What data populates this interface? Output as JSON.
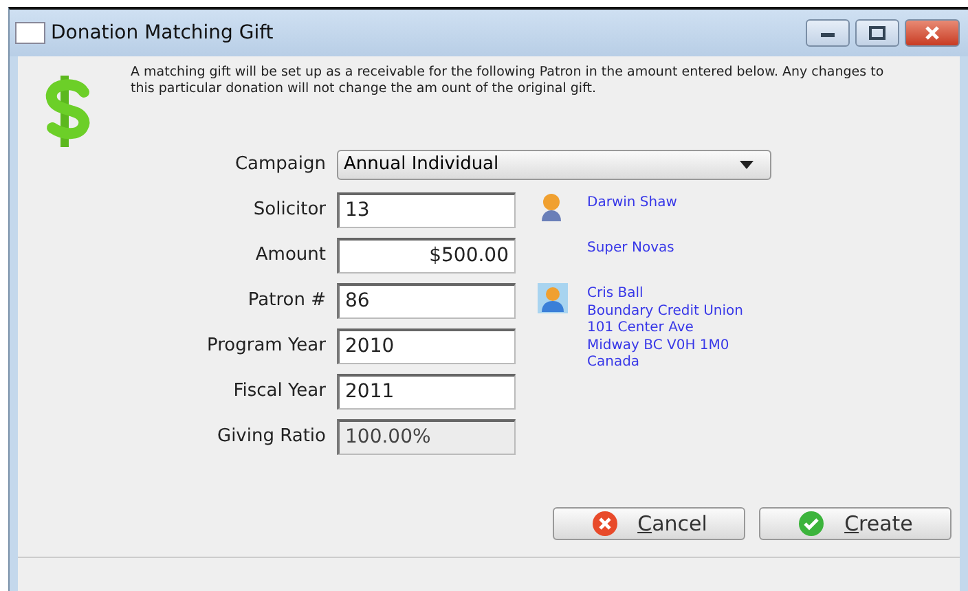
{
  "window": {
    "title": "Donation Matching Gift"
  },
  "message": "A matching gift will be set up as a receivable for the following Patron in the amount entered below.  Any changes to this particular donation will not change the am ount of the original gift.",
  "fields": [
    {
      "label": "Campaign",
      "kind": "dropdown",
      "value": "Annual Individual"
    },
    {
      "label": "Solicitor",
      "kind": "text",
      "value": "13",
      "info": {
        "kind": "person",
        "lines": [
          "Darwin Shaw"
        ]
      }
    },
    {
      "label": "Amount",
      "kind": "money",
      "value": "$500.00",
      "info": {
        "lines": [
          "Super Novas"
        ]
      }
    },
    {
      "label": "Patron #",
      "kind": "text",
      "value": "86",
      "info": {
        "kind": "card",
        "lines": [
          "Cris Ball",
          "Boundary Credit Union",
          "101 Center Ave",
          "Midway BC V0H 1M0",
          "Canada"
        ]
      }
    },
    {
      "label": "Program Year",
      "kind": "text",
      "value": "2010"
    },
    {
      "label": "Fiscal Year",
      "kind": "text",
      "value": "2011"
    },
    {
      "label": "Giving Ratio",
      "kind": "readonly",
      "value": "100.00%"
    }
  ],
  "buttons": [
    {
      "label": "Cancel",
      "kind": "cancel"
    },
    {
      "label": "Create",
      "kind": "create"
    }
  ]
}
